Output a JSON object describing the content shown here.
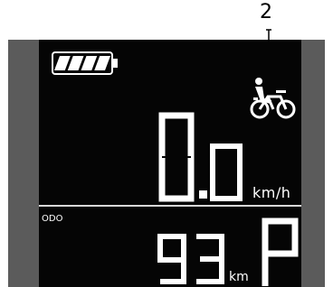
{
  "callout": {
    "label": "2"
  },
  "display": {
    "battery": {
      "level": 1.0,
      "bars_filled": 4,
      "bars_total": 4
    },
    "pedal_assist_icon": "bicycle-rider-icon",
    "speed": {
      "value": "0.0",
      "unit": "km/h"
    },
    "odometer": {
      "label": "ODO",
      "value": "93",
      "unit": "km"
    },
    "mode": {
      "value": "P"
    }
  },
  "colors": {
    "screen_bg": "#050505",
    "bezel": "#5b5b5b",
    "segment": "#ffffff"
  }
}
